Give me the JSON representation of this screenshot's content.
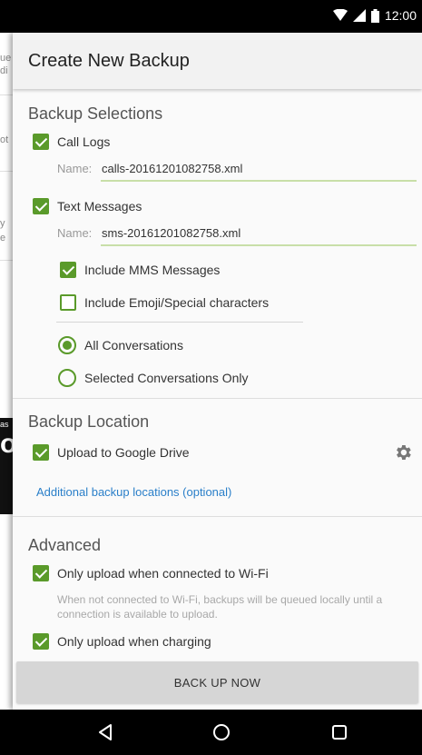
{
  "status_bar": {
    "time": "12:00"
  },
  "background_app": {
    "fragments": [
      "ue",
      "di",
      "ot",
      "y",
      "e",
      "as",
      "o"
    ]
  },
  "dialog": {
    "title": "Create New Backup",
    "backup_selections": {
      "title": "Backup Selections",
      "call_logs": {
        "label": "Call Logs",
        "checked": true,
        "name_prefix": "Name:",
        "file_name": "calls-20161201082758.xml"
      },
      "text_messages": {
        "label": "Text Messages",
        "checked": true,
        "name_prefix": "Name:",
        "file_name": "sms-20161201082758.xml"
      },
      "include_mms": {
        "label": "Include MMS Messages",
        "checked": true
      },
      "include_emoji": {
        "label": "Include Emoji/Special characters",
        "checked": false
      },
      "all_conversations": {
        "label": "All Conversations",
        "selected": true
      },
      "selected_conversations": {
        "label": "Selected Conversations Only",
        "selected": false
      }
    },
    "backup_location": {
      "title": "Backup Location",
      "google_drive": {
        "label": "Upload to Google Drive",
        "checked": true
      },
      "additional_link": "Additional backup locations (optional)"
    },
    "advanced": {
      "title": "Advanced",
      "wifi_only": {
        "label": "Only upload when connected to Wi-Fi",
        "checked": true
      },
      "wifi_hint": "When not connected to Wi-Fi, backups will be queued locally until a connection is available to upload.",
      "charging_only": {
        "label": "Only upload when charging",
        "checked": true
      }
    },
    "backup_button": "BACK UP NOW"
  },
  "colors": {
    "accent": "#5a9a2a",
    "link": "#2a7fc9"
  }
}
